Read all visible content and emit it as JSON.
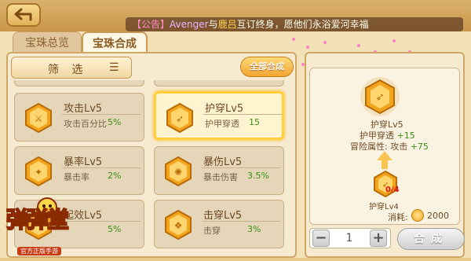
{
  "notice": {
    "tag": "【公告】",
    "name1": "Avenger",
    "mid": "与",
    "name2": "鹿吕",
    "rest": "互订终身，愿他们永浴爱河幸福"
  },
  "tabs": [
    {
      "label": "宝珠总览",
      "active": false
    },
    {
      "label": "宝珠合成",
      "active": true
    }
  ],
  "filter_label": "筛 选",
  "all_synth_label": "全部合成",
  "cards": [
    {
      "name": "攻击Lv5",
      "attr": "攻击百分比",
      "value": "5%",
      "selected": false,
      "icon": "attack-gem-icon"
    },
    {
      "name": "护穿Lv5",
      "attr": "护甲穿透",
      "value": "15",
      "selected": true,
      "icon": "armor-pierce-gem-icon"
    },
    {
      "name": "暴率Lv5",
      "attr": "暴击率",
      "value": "2%",
      "selected": false,
      "icon": "crit-rate-gem-icon"
    },
    {
      "name": "暴伤Lv5",
      "attr": "暴击伤害",
      "value": "3.5%",
      "selected": false,
      "icon": "crit-damage-gem-icon"
    },
    {
      "name": "起效Lv5",
      "attr": "",
      "value": "5%",
      "selected": false,
      "icon": "effect-gem-icon"
    },
    {
      "name": "击穿Lv5",
      "attr": "击穿",
      "value": "3%",
      "selected": false,
      "icon": "penetrate-gem-icon"
    }
  ],
  "detail": {
    "result_name": "护穿Lv5",
    "result_attr": "护甲穿透",
    "result_attr_val": "+15",
    "adventure_label": "冒险属性: 攻击",
    "adventure_val": "+75",
    "material_name": "护穿Lv4",
    "material_count": "0/4",
    "cost_label": "消耗:",
    "cost_value": "2000"
  },
  "quantity": {
    "minus": "−",
    "value": "1",
    "plus": "+"
  },
  "synth_label": "合成",
  "logo": {
    "title": "弹弹堂",
    "subtitle": "官方正版手游"
  },
  "colors": {
    "accent": "#ffcf3d",
    "gem": "#f2a41d",
    "positive": "#3a8f16"
  }
}
